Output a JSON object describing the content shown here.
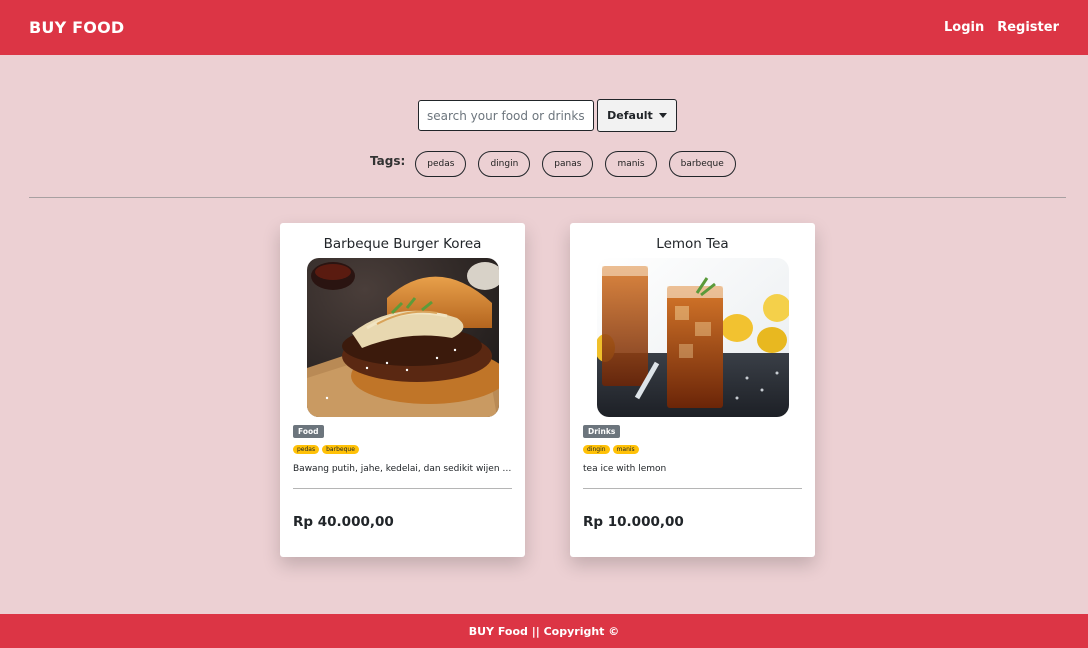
{
  "nav": {
    "brand": "BUY FOOD",
    "login": "Login",
    "register": "Register"
  },
  "search": {
    "placeholder": "search your food or drinks",
    "sort_label": "Default"
  },
  "tags": {
    "label": "Tags:",
    "items": [
      "pedas",
      "dingin",
      "panas",
      "manis",
      "barbeque"
    ]
  },
  "products": [
    {
      "title": "Barbeque Burger Korea",
      "image": "burger-photo",
      "category": "Food",
      "tags": [
        "pedas",
        "barbeque"
      ],
      "description": "Bawang putih, jahe, kedelai, dan sedikit wijen d...",
      "price": "Rp 40.000,00"
    },
    {
      "title": "Lemon Tea",
      "image": "iced-lemon-tea-photo",
      "category": "Drinks",
      "tags": [
        "dingin",
        "manis"
      ],
      "description": "tea ice with lemon",
      "price": "Rp 10.000,00"
    }
  ],
  "footer": {
    "text": "BUY Food || Copyright ©"
  },
  "colors": {
    "primary": "#dc3545",
    "background": "#ecd0d3",
    "tag_badge": "#ffc107",
    "category_badge": "#6c757d"
  }
}
